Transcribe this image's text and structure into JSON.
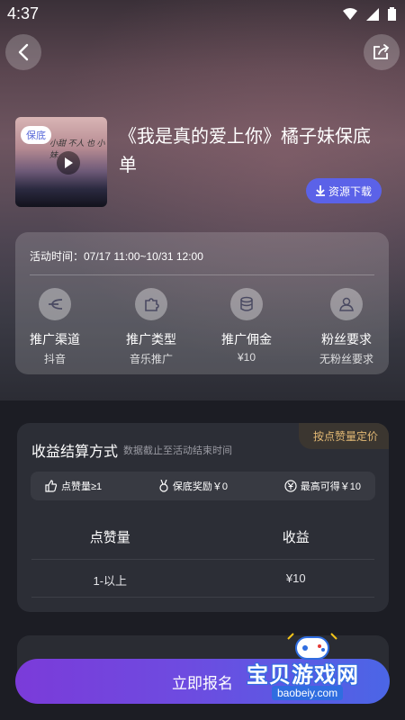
{
  "status": {
    "time": "4:37"
  },
  "song": {
    "cover_tag": "保底",
    "cover_script": "小甜 不人 也 小妹",
    "title": "《我是真的爱上你》橘子妹保底单",
    "download_label": "资源下载"
  },
  "activity": {
    "period": "活动时间：07/17 11:00~10/31 12:00",
    "features": [
      {
        "label": "推广渠道",
        "value": "抖音",
        "icon": "share-icon"
      },
      {
        "label": "推广类型",
        "value": "音乐推广",
        "icon": "puzzle-icon"
      },
      {
        "label": "推广佣金",
        "value": "¥10",
        "icon": "coins-icon"
      },
      {
        "label": "粉丝要求",
        "value": "无粉丝要求",
        "icon": "user-icon"
      }
    ]
  },
  "earnings": {
    "badge": "按点赞量定价",
    "title": "收益结算方式",
    "subtitle": "数据截止至活动结束时间",
    "chips": [
      {
        "label": "点赞量≥1",
        "icon": "thumb-up-icon"
      },
      {
        "label": "保底奖励￥0",
        "icon": "medal-icon"
      },
      {
        "label": "最高可得￥10",
        "icon": "yen-icon"
      }
    ],
    "table": {
      "headers": [
        "点赞量",
        "收益"
      ],
      "rows": [
        [
          "1-以上",
          "¥10"
        ]
      ]
    }
  },
  "cta": {
    "label": "立即报名"
  },
  "watermark": {
    "text": "宝贝游戏网",
    "url": "baobeiy.com"
  },
  "colors": {
    "accent": "#5b62e8",
    "badge": "#e2b874",
    "cta_start": "#7b3bd9",
    "cta_end": "#4b66e6"
  }
}
